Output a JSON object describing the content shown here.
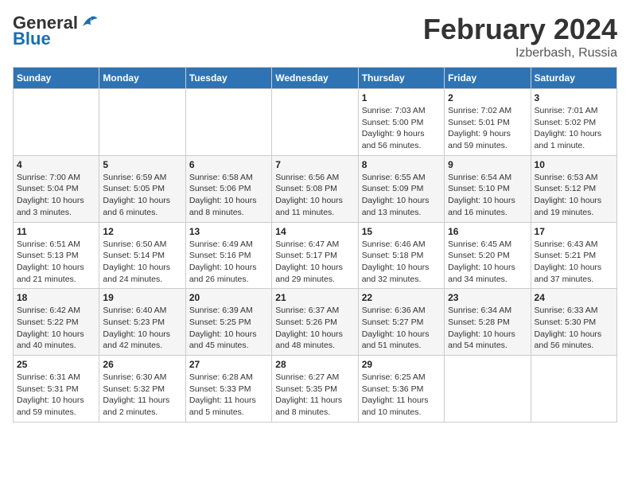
{
  "logo": {
    "general": "General",
    "blue": "Blue"
  },
  "title": {
    "month_year": "February 2024",
    "location": "Izberbash, Russia"
  },
  "calendar": {
    "headers": [
      "Sunday",
      "Monday",
      "Tuesday",
      "Wednesday",
      "Thursday",
      "Friday",
      "Saturday"
    ],
    "weeks": [
      [
        {
          "day": "",
          "info": ""
        },
        {
          "day": "",
          "info": ""
        },
        {
          "day": "",
          "info": ""
        },
        {
          "day": "",
          "info": ""
        },
        {
          "day": "1",
          "info": "Sunrise: 7:03 AM\nSunset: 5:00 PM\nDaylight: 9 hours\nand 56 minutes."
        },
        {
          "day": "2",
          "info": "Sunrise: 7:02 AM\nSunset: 5:01 PM\nDaylight: 9 hours\nand 59 minutes."
        },
        {
          "day": "3",
          "info": "Sunrise: 7:01 AM\nSunset: 5:02 PM\nDaylight: 10 hours\nand 1 minute."
        }
      ],
      [
        {
          "day": "4",
          "info": "Sunrise: 7:00 AM\nSunset: 5:04 PM\nDaylight: 10 hours\nand 3 minutes."
        },
        {
          "day": "5",
          "info": "Sunrise: 6:59 AM\nSunset: 5:05 PM\nDaylight: 10 hours\nand 6 minutes."
        },
        {
          "day": "6",
          "info": "Sunrise: 6:58 AM\nSunset: 5:06 PM\nDaylight: 10 hours\nand 8 minutes."
        },
        {
          "day": "7",
          "info": "Sunrise: 6:56 AM\nSunset: 5:08 PM\nDaylight: 10 hours\nand 11 minutes."
        },
        {
          "day": "8",
          "info": "Sunrise: 6:55 AM\nSunset: 5:09 PM\nDaylight: 10 hours\nand 13 minutes."
        },
        {
          "day": "9",
          "info": "Sunrise: 6:54 AM\nSunset: 5:10 PM\nDaylight: 10 hours\nand 16 minutes."
        },
        {
          "day": "10",
          "info": "Sunrise: 6:53 AM\nSunset: 5:12 PM\nDaylight: 10 hours\nand 19 minutes."
        }
      ],
      [
        {
          "day": "11",
          "info": "Sunrise: 6:51 AM\nSunset: 5:13 PM\nDaylight: 10 hours\nand 21 minutes."
        },
        {
          "day": "12",
          "info": "Sunrise: 6:50 AM\nSunset: 5:14 PM\nDaylight: 10 hours\nand 24 minutes."
        },
        {
          "day": "13",
          "info": "Sunrise: 6:49 AM\nSunset: 5:16 PM\nDaylight: 10 hours\nand 26 minutes."
        },
        {
          "day": "14",
          "info": "Sunrise: 6:47 AM\nSunset: 5:17 PM\nDaylight: 10 hours\nand 29 minutes."
        },
        {
          "day": "15",
          "info": "Sunrise: 6:46 AM\nSunset: 5:18 PM\nDaylight: 10 hours\nand 32 minutes."
        },
        {
          "day": "16",
          "info": "Sunrise: 6:45 AM\nSunset: 5:20 PM\nDaylight: 10 hours\nand 34 minutes."
        },
        {
          "day": "17",
          "info": "Sunrise: 6:43 AM\nSunset: 5:21 PM\nDaylight: 10 hours\nand 37 minutes."
        }
      ],
      [
        {
          "day": "18",
          "info": "Sunrise: 6:42 AM\nSunset: 5:22 PM\nDaylight: 10 hours\nand 40 minutes."
        },
        {
          "day": "19",
          "info": "Sunrise: 6:40 AM\nSunset: 5:23 PM\nDaylight: 10 hours\nand 42 minutes."
        },
        {
          "day": "20",
          "info": "Sunrise: 6:39 AM\nSunset: 5:25 PM\nDaylight: 10 hours\nand 45 minutes."
        },
        {
          "day": "21",
          "info": "Sunrise: 6:37 AM\nSunset: 5:26 PM\nDaylight: 10 hours\nand 48 minutes."
        },
        {
          "day": "22",
          "info": "Sunrise: 6:36 AM\nSunset: 5:27 PM\nDaylight: 10 hours\nand 51 minutes."
        },
        {
          "day": "23",
          "info": "Sunrise: 6:34 AM\nSunset: 5:28 PM\nDaylight: 10 hours\nand 54 minutes."
        },
        {
          "day": "24",
          "info": "Sunrise: 6:33 AM\nSunset: 5:30 PM\nDaylight: 10 hours\nand 56 minutes."
        }
      ],
      [
        {
          "day": "25",
          "info": "Sunrise: 6:31 AM\nSunset: 5:31 PM\nDaylight: 10 hours\nand 59 minutes."
        },
        {
          "day": "26",
          "info": "Sunrise: 6:30 AM\nSunset: 5:32 PM\nDaylight: 11 hours\nand 2 minutes."
        },
        {
          "day": "27",
          "info": "Sunrise: 6:28 AM\nSunset: 5:33 PM\nDaylight: 11 hours\nand 5 minutes."
        },
        {
          "day": "28",
          "info": "Sunrise: 6:27 AM\nSunset: 5:35 PM\nDaylight: 11 hours\nand 8 minutes."
        },
        {
          "day": "29",
          "info": "Sunrise: 6:25 AM\nSunset: 5:36 PM\nDaylight: 11 hours\nand 10 minutes."
        },
        {
          "day": "",
          "info": ""
        },
        {
          "day": "",
          "info": ""
        }
      ]
    ]
  }
}
